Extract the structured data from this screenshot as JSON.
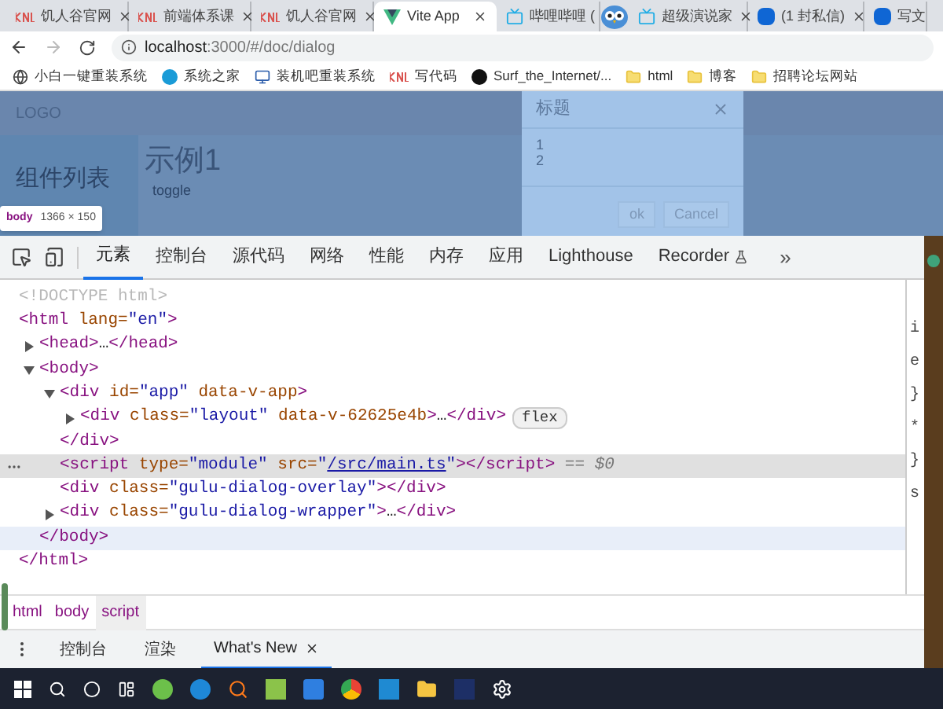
{
  "browser": {
    "tabs": [
      {
        "label": "饥人谷官网",
        "kind": "textlogo",
        "selected": false
      },
      {
        "label": "前端体系课",
        "kind": "textlogo",
        "selected": false
      },
      {
        "label": "饥人谷官网",
        "kind": "textlogo",
        "selected": false
      },
      {
        "label": "Vite App",
        "kind": "vlogo",
        "selected": true
      },
      {
        "label": "哔哩哔哩 (",
        "kind": "tv",
        "selected": false
      },
      {
        "label": "超级演说家",
        "kind": "tv",
        "selected": false
      },
      {
        "label": "(1 封私信)",
        "kind": "square",
        "selected": false
      },
      {
        "label": "写文",
        "kind": "square",
        "selected": false
      }
    ],
    "address": {
      "host": "localhost",
      "path": ":3000/#/doc/dialog"
    },
    "bookmarks": [
      {
        "label": "小白一键重装系统",
        "kind": "globe"
      },
      {
        "label": "系统之家",
        "kind": "circle"
      },
      {
        "label": "装机吧重装系统",
        "kind": "monitor"
      },
      {
        "label": "写代码",
        "kind": "textlogo"
      },
      {
        "label": "Surf_the_Internet/...",
        "kind": "cat"
      },
      {
        "label": "html",
        "kind": "folder"
      },
      {
        "label": "博客",
        "kind": "folder"
      },
      {
        "label": "招聘论坛网站",
        "kind": "folder"
      }
    ]
  },
  "page": {
    "logo": "LOGO",
    "sidebar_title": "组件列表",
    "heading": "示例1",
    "toggle": "toggle",
    "dialog": {
      "title": "标题",
      "lines": [
        "1",
        "2"
      ],
      "buttons": [
        "ok",
        "Cancel"
      ]
    },
    "inspect_tooltip": {
      "tag": "body",
      "size": "1366 × 150"
    }
  },
  "devtools": {
    "tabs": [
      {
        "label": "元素",
        "selected": true
      },
      {
        "label": "控制台",
        "selected": false
      },
      {
        "label": "源代码",
        "selected": false
      },
      {
        "label": "网络",
        "selected": false
      },
      {
        "label": "性能",
        "selected": false
      },
      {
        "label": "内存",
        "selected": false
      },
      {
        "label": "应用",
        "selected": false
      },
      {
        "label": "Lighthouse",
        "selected": false
      },
      {
        "label": "Recorder",
        "selected": false,
        "kind": "flask"
      }
    ],
    "more": "»",
    "tree": [
      {
        "segments": [
          {
            "kind": "doctype",
            "text": "<!DOCTYPE html>"
          }
        ],
        "selected": false,
        "highlighted": false
      },
      {
        "segments": [
          {
            "kind": "tag",
            "text": "<html"
          },
          {
            "kind": "attr",
            "text": " lang="
          },
          {
            "kind": "value",
            "text": "\"en\""
          },
          {
            "kind": "tag",
            "text": ">"
          }
        ],
        "selected": false,
        "highlighted": false,
        "children": [
          {
            "segments": [
              {
                "kind": "tag",
                "text": "<head>"
              },
              {
                "kind": "text",
                "text": "…"
              },
              {
                "kind": "tag",
                "text": "</head>"
              }
            ],
            "expanded": false,
            "selected": false,
            "highlighted": false
          },
          {
            "segments": [
              {
                "kind": "tag",
                "text": "<body>"
              }
            ],
            "expanded": true,
            "selected": false,
            "highlighted": false,
            "children": [
              {
                "segments": [
                  {
                    "kind": "tag",
                    "text": "<div"
                  },
                  {
                    "kind": "attr",
                    "text": " id="
                  },
                  {
                    "kind": "value",
                    "text": "\"app\""
                  },
                  {
                    "kind": "attr",
                    "text": " data-v-app"
                  },
                  {
                    "kind": "tag",
                    "text": ">"
                  }
                ],
                "expanded": true,
                "selected": false,
                "highlighted": false,
                "children": [
                  {
                    "segments": [
                      {
                        "kind": "tag",
                        "text": "<div"
                      },
                      {
                        "kind": "attr",
                        "text": " class="
                      },
                      {
                        "kind": "value",
                        "text": "\"layout\""
                      },
                      {
                        "kind": "attr",
                        "text": " data-v-62625e4b"
                      },
                      {
                        "kind": "tag",
                        "text": ">"
                      },
                      {
                        "kind": "text",
                        "text": "…"
                      },
                      {
                        "kind": "tag",
                        "text": "</div>"
                      },
                      {
                        "kind": "badge",
                        "text": "flex"
                      }
                    ],
                    "expanded": false,
                    "selected": false,
                    "highlighted": false
                  }
                ]
              },
              {
                "segments": [
                  {
                    "kind": "tag",
                    "text": "</div>"
                  }
                ],
                "selected": false,
                "highlighted": false
              },
              {
                "segments": [
                  {
                    "kind": "tag",
                    "text": "<script"
                  },
                  {
                    "kind": "attr",
                    "text": " type="
                  },
                  {
                    "kind": "value",
                    "text": "\"module\""
                  },
                  {
                    "kind": "attr",
                    "text": " src="
                  },
                  {
                    "kind": "value",
                    "text": "\""
                  },
                  {
                    "kind": "link",
                    "text": "/src/main.ts"
                  },
                  {
                    "kind": "value",
                    "text": "\""
                  },
                  {
                    "kind": "tag",
                    "text": "></script>"
                  },
                  {
                    "kind": "note",
                    "text": " == $0"
                  }
                ],
                "selected": true,
                "highlighted": false
              },
              {
                "segments": [
                  {
                    "kind": "tag",
                    "text": "<div"
                  },
                  {
                    "kind": "attr",
                    "text": " class="
                  },
                  {
                    "kind": "value",
                    "text": "\"gulu-dialog-overlay\""
                  },
                  {
                    "kind": "tag",
                    "text": "></div>"
                  }
                ],
                "selected": false,
                "highlighted": false
              },
              {
                "segments": [
                  {
                    "kind": "tag",
                    "text": "<div"
                  },
                  {
                    "kind": "attr",
                    "text": " class="
                  },
                  {
                    "kind": "value",
                    "text": "\"gulu-dialog-wrapper\""
                  },
                  {
                    "kind": "tag",
                    "text": ">"
                  },
                  {
                    "kind": "text",
                    "text": "…"
                  },
                  {
                    "kind": "tag",
                    "text": "</div>"
                  }
                ],
                "expanded": false,
                "selected": false,
                "highlighted": false
              }
            ]
          },
          {
            "segments": [
              {
                "kind": "tag",
                "text": "</body>"
              }
            ],
            "selected": false,
            "highlighted": true
          }
        ]
      },
      {
        "segments": [
          {
            "kind": "tag",
            "text": "</html>"
          }
        ],
        "selected": false,
        "highlighted": false
      }
    ],
    "styles_fragments": [
      "i",
      "e",
      "}",
      "*",
      "}",
      "s"
    ],
    "breadcrumbs": [
      {
        "label": "html",
        "selected": false
      },
      {
        "label": "body",
        "selected": false
      },
      {
        "label": "script",
        "selected": true
      }
    ],
    "drawer_tabs": [
      {
        "label": "控制台",
        "selected": false
      },
      {
        "label": "渲染",
        "selected": false
      },
      {
        "label": "What's New",
        "selected": true,
        "closable": true
      }
    ]
  }
}
